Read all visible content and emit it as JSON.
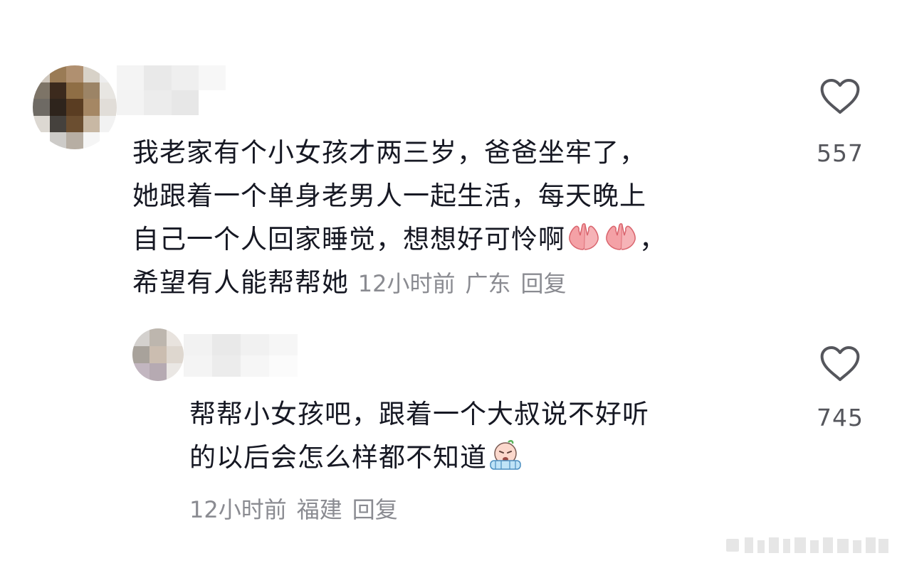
{
  "colors": {
    "text": "#161823",
    "meta": "#8a8b91",
    "like_icon": "#55565c"
  },
  "comment": {
    "lines": [
      "我老家有个小女孩才两三岁，爸爸坐牢了，",
      "她跟着一个单身老男人一起生活，每天晚上",
      "自己一个人回家睡觉，想想好可怜啊",
      "，",
      "希望有人能帮帮她"
    ],
    "emojis": [
      "praying-hands-emoji",
      "praying-hands-emoji"
    ],
    "time": "12小时前",
    "location": "广东",
    "reply_label": "回复",
    "likes": "557"
  },
  "reply": {
    "lines": [
      "帮帮小女孩吧，跟着一个大叔说不好听",
      "的以后会怎么样都不知道"
    ],
    "emoji": "crying-emoji",
    "time": "12小时前",
    "location": "福建",
    "reply_label": "回复",
    "likes": "745"
  },
  "icons": {
    "like": "heart-outline-icon"
  }
}
